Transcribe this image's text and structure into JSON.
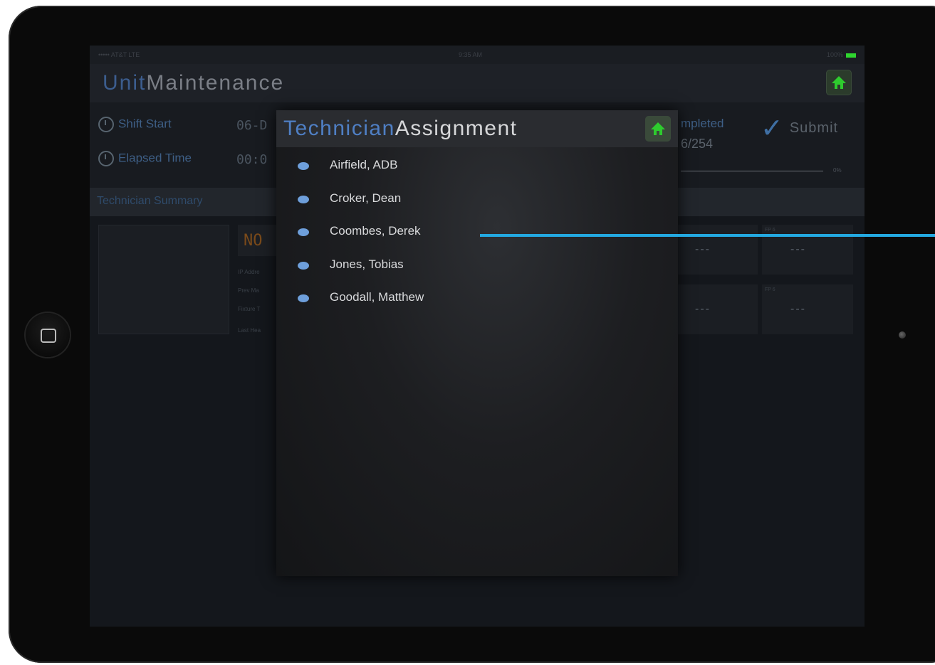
{
  "app": {
    "title_accent": "Unit",
    "title_rest": "Maintenance"
  },
  "statusbar": {
    "carrier": "••••• AT&T LTE  ",
    "time": "9:35 AM",
    "battery": "100%"
  },
  "info": {
    "shift_start_label": "Shift Start",
    "shift_start_value": "06-D",
    "elapsed_label": "Elapsed Time",
    "elapsed_value": "00:0",
    "completed_label": "mpleted",
    "completed_count": "6/254",
    "progress_pct": "0%",
    "progress_fraction": 0,
    "submit_label": "Submit"
  },
  "section": {
    "title": "Technician Summary"
  },
  "summary": {
    "status_code": "NO",
    "lines": [
      "IP Addre",
      "Prev Ma",
      "Fixture T",
      "Last Hea"
    ],
    "tiles": [
      {
        "key": "",
        "value": "---"
      },
      {
        "key": "FP 6",
        "value": "---"
      },
      {
        "key": "",
        "value": "---"
      },
      {
        "key": "FP 6",
        "value": "---"
      }
    ]
  },
  "modal": {
    "title_accent": "Technician",
    "title_rest": "Assignment",
    "technicians": [
      "Airfield, ADB",
      "Croker, Dean",
      "Coombes, Derek",
      "Jones, Tobias",
      "Goodall, Matthew"
    ]
  },
  "colors": {
    "accent_blue": "#4f7fc4",
    "bullet_blue": "#6e9fdb",
    "home_green": "#2ecc2e",
    "pointer": "#23a9e1"
  }
}
